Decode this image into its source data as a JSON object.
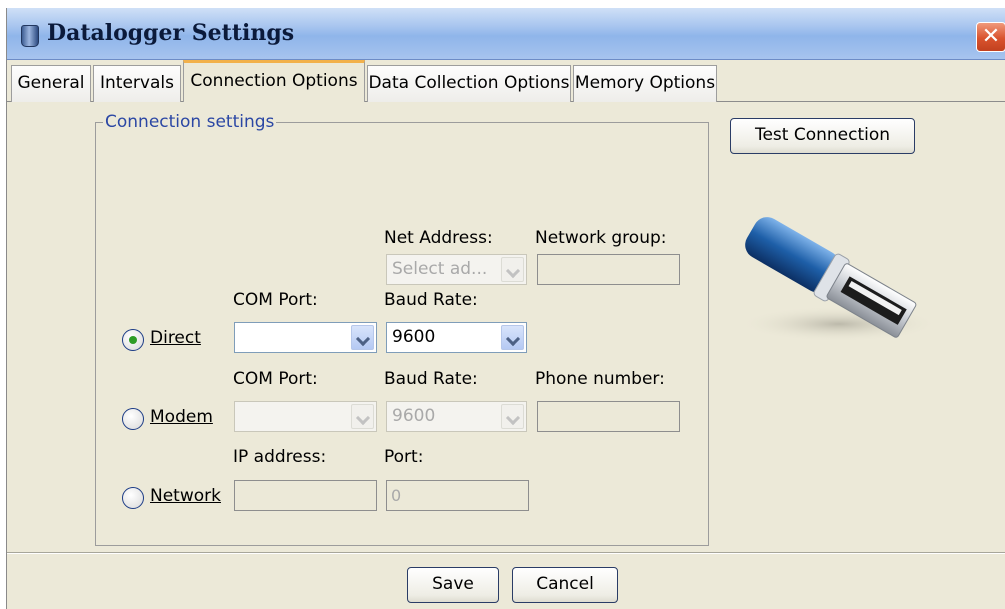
{
  "window": {
    "title": "Datalogger Settings",
    "close": "✕"
  },
  "tabs": [
    {
      "label": "General"
    },
    {
      "label": "Intervals"
    },
    {
      "label": "Connection Options"
    },
    {
      "label": "Data Collection Options"
    },
    {
      "label": "Memory Options"
    }
  ],
  "connection_settings": {
    "group_label": "Connection settings",
    "direct": {
      "label": "Direct",
      "selected": true,
      "net_address_label": "Net Address:",
      "net_address_placeholder": "Select ad...",
      "network_group_label": "Network group:",
      "network_group_value": "",
      "com_port_label": "COM Port:",
      "com_port_value": "",
      "baud_rate_label": "Baud Rate:",
      "baud_rate_value": "9600"
    },
    "modem": {
      "label": "Modem",
      "selected": false,
      "com_port_label": "COM Port:",
      "com_port_value": "",
      "baud_rate_label": "Baud Rate:",
      "baud_rate_value": "9600",
      "phone_number_label": "Phone number:",
      "phone_number_value": ""
    },
    "network": {
      "label": "Network",
      "selected": false,
      "ip_address_label": "IP address:",
      "ip_address_value": "",
      "port_label": "Port:",
      "port_value": "0"
    }
  },
  "test_connection_label": "Test Connection",
  "footer": {
    "save_label": "Save",
    "cancel_label": "Cancel"
  },
  "icons": {
    "window_icon": "datalogger-icon",
    "usb_icon": "usb-plug-icon"
  },
  "colors": {
    "group_label": "#2b47a4",
    "active_tab_accent": "#f2b14b",
    "usb_blue": "#1e5fa8"
  }
}
